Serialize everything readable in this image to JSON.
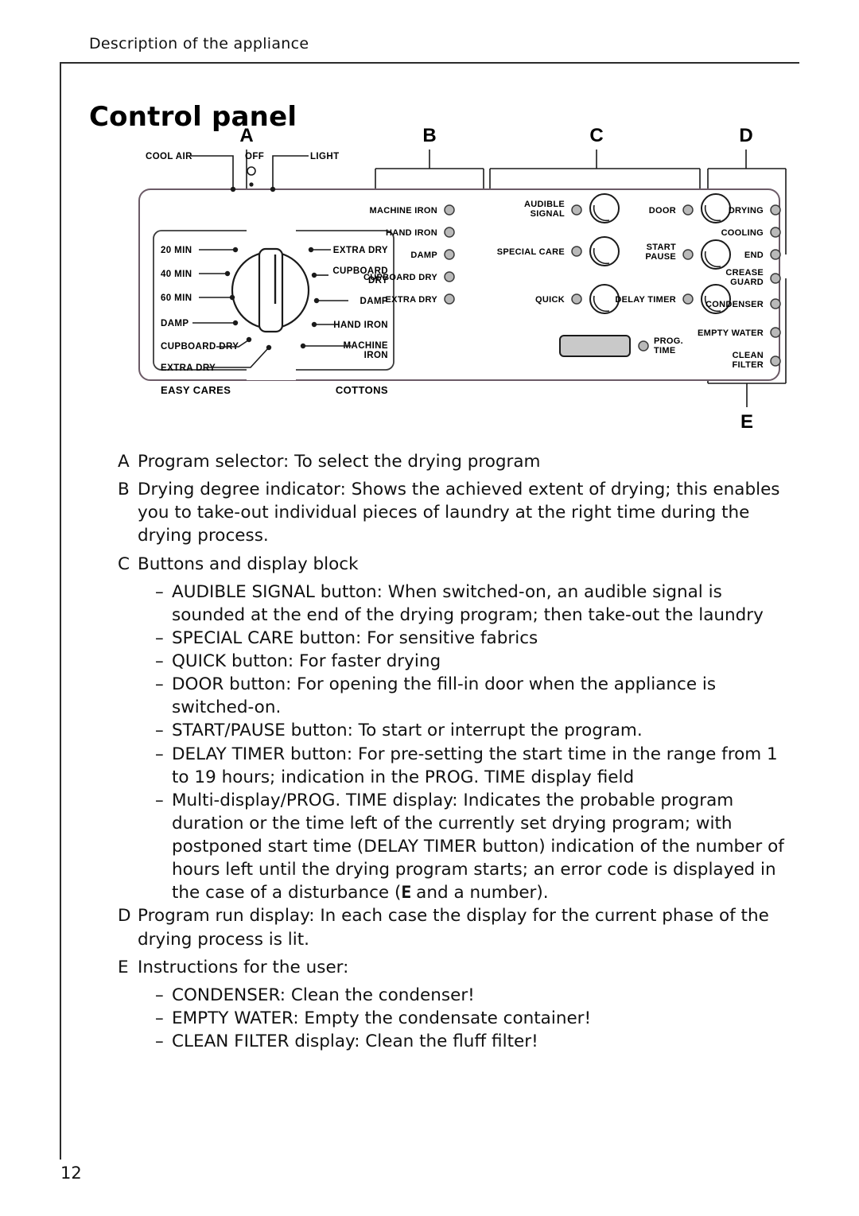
{
  "page": {
    "header": "Description of the appliance",
    "title": "Control panel",
    "number": "12"
  },
  "diagram": {
    "callouts": [
      "A",
      "B",
      "C",
      "D",
      "E"
    ],
    "program_selector": {
      "top_labels": [
        "COOL AIR",
        "OFF",
        "LIGHT"
      ],
      "left_group_label": "EASY CARES",
      "right_group_label": "COTTONS",
      "left_timed": [
        "20 MIN",
        "40 MIN",
        "60 MIN"
      ],
      "left_levels": [
        "DAMP",
        "CUPBOARD DRY",
        "EXTRA DRY"
      ],
      "right_levels": [
        "EXTRA DRY",
        "CUPBOARD DRY",
        "DAMP",
        "HAND IRON",
        "MACHINE IRON"
      ]
    },
    "drying_degree_indicator": [
      "MACHINE IRON",
      "HAND IRON",
      "DAMP",
      "CUPBOARD DRY",
      "EXTRA DRY"
    ],
    "button_block": {
      "left_buttons": [
        "AUDIBLE SIGNAL",
        "SPECIAL CARE",
        "QUICK"
      ],
      "right_buttons": [
        "DOOR",
        "START PAUSE",
        "DELAY TIMER"
      ],
      "display_label": "PROG. TIME",
      "display_value": ""
    },
    "program_run_display": [
      "DRYING",
      "COOLING",
      "END",
      "CREASE GUARD"
    ],
    "user_instructions": [
      "CONDENSER",
      "EMPTY WATER",
      "CLEAN FILTER"
    ]
  },
  "descriptions": [
    {
      "marker": "A",
      "text": "Program selector: To select the drying program",
      "subs": []
    },
    {
      "marker": "B",
      "text": "Drying degree indicator: Shows the achieved extent of drying; this enables you to take-out individual pieces of laundry at the right time during the drying process.",
      "subs": []
    },
    {
      "marker": "C",
      "text": "Buttons and display block",
      "subs": [
        "AUDIBLE SIGNAL button: When switched-on, an audible signal is sounded at the end of the drying program; then take-out the laundry",
        "SPECIAL CARE button: For sensitive fabrics",
        "QUICK button: For faster drying",
        "DOOR button: For opening the fill-in door when the appliance is switched-on.",
        "START/PAUSE button: To start or interrupt the program.",
        "DELAY TIMER button: For pre-setting the start time in the range from 1 to 19 hours; indication in the PROG. TIME display field",
        "Multi-display/PROG. TIME display: Indicates the probable program duration or the time left of the currently set drying program; with postponed start time (DELAY TIMER button) indication of the number of hours left until the drying program starts; an error code is displayed in the case of a disturbance (E and a number)."
      ]
    },
    {
      "marker": "D",
      "text": "Program run display: In each case the display for the current phase of the drying process is lit.",
      "subs": []
    },
    {
      "marker": "E",
      "text": "Instructions for the user:",
      "subs": [
        "CONDENSER: Clean the condenser!",
        "EMPTY WATER: Empty the condensate container!",
        "CLEAN FILTER display: Clean the fluff filter!"
      ]
    }
  ],
  "colors": {
    "ink": "#111111",
    "panel_border": "#6b5a66",
    "led_fill": "#b9b9b9",
    "display_fill": "#c9c9c9"
  }
}
